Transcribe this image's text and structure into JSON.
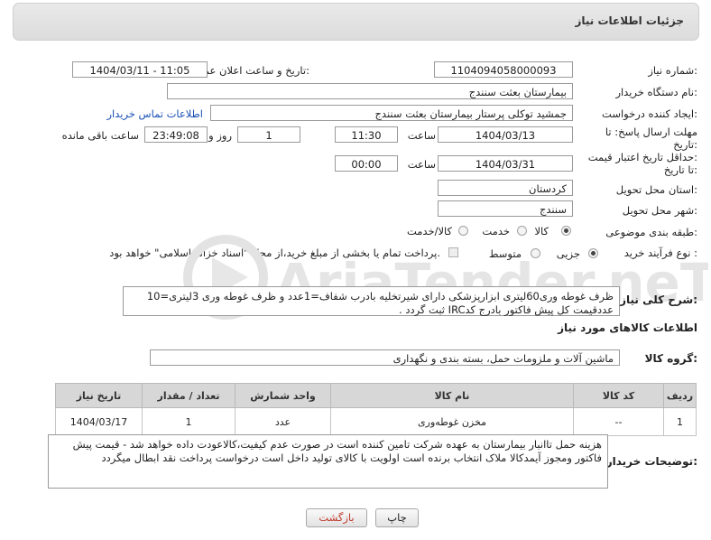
{
  "header": {
    "title": "جزئیات اطلاعات نیاز"
  },
  "form": {
    "need_number": {
      "label": "شماره نیاز:",
      "value": "1104094058000093"
    },
    "announce": {
      "label": "تاریخ و ساعت اعلان عمومی:",
      "value": "1404/03/11 - 11:05"
    },
    "buyer_org": {
      "label": "نام دستگاه خریدار:",
      "value": "بیمارستان بعثت سنندج"
    },
    "creator": {
      "label": "ایجاد کننده درخواست:",
      "value": "جمشید  توکلی پرستار بیمارستان بعثت سنندج",
      "contact_link": "اطلاعات تماس خریدار"
    },
    "deadline": {
      "label_line1": "مهلت ارسال پاسخ: تا",
      "label_line2": "تاریخ:",
      "date": "1404/03/13",
      "time_label": "ساعت",
      "time": "11:30",
      "days": "1",
      "days_label": "روز و",
      "remaining": "23:49:08",
      "remaining_label": "ساعت باقی مانده"
    },
    "price_validity": {
      "label_line1": "حداقل تاریخ اعتبار قیمت:",
      "label_line2": "تا تاریخ:",
      "date": "1404/03/31",
      "time_label": "ساعت",
      "time": "00:00"
    },
    "province": {
      "label": "استان محل تحویل:",
      "value": "کردستان"
    },
    "city": {
      "label": "شهر محل تحویل:",
      "value": "سنندج"
    },
    "category": {
      "label": "طبقه بندی موضوعی:",
      "options": [
        "کالا",
        "خدمت",
        "کالا/خدمت"
      ],
      "selected": "کالا"
    },
    "process": {
      "label": "نوع فرآیند خرید :",
      "options": [
        "جزیی",
        "متوسط"
      ],
      "selected": "جزیی",
      "note": "پرداخت تمام یا بخشی از مبلغ خرید،از محل \"اسناد خزانه اسلامی\" خواهد بود."
    }
  },
  "description": {
    "label": "شرح کلی نیاز:",
    "line1": "ظرف غوطه وری60لیتری ابزارپزشکی دارای شیرتخلیه بادرب شفاف=1عدد و ظرف غوطه وری 3لیتری=10",
    "line2": "عددقیمت کل پیش فاکتور بادرج کدIRC ثبت گردد ."
  },
  "goods": {
    "section_title": "اطلاعات کالاهای مورد نیاز",
    "group_label": "گروه کالا:",
    "group_value": "ماشین آلات و ملزومات حمل، بسته بندی و نگهداری",
    "columns": [
      "ردیف",
      "کد کالا",
      "نام کالا",
      "واحد شمارش",
      "تعداد / مقدار",
      "تاریخ نیاز"
    ],
    "rows": [
      {
        "row": "1",
        "code": "--",
        "name": "مخزن غوطه‌وری",
        "unit": "عدد",
        "qty": "1",
        "date": "1404/03/17"
      }
    ]
  },
  "buyer_notes": {
    "label": "توضیحات خریدار:",
    "line1": "هزینه حمل تاانبار بیمارستان به عهده شرکت تامین کننده است در صورت عدم کیفیت،کالاعودت داده خواهد شد - قیمت پیش",
    "line2": "فاکتور ومجوز آیمدکالا ملاک انتخاب برنده است اولویت با کالای تولید داخل است درخواست پرداخت نقد ابطال میگردد"
  },
  "buttons": {
    "print": "چاپ",
    "back": "بازگشت"
  },
  "watermark": {
    "text": "AriaTender.neT"
  },
  "colors": {
    "link": "#1a4fb5",
    "back_button_text": "#c0392b"
  }
}
